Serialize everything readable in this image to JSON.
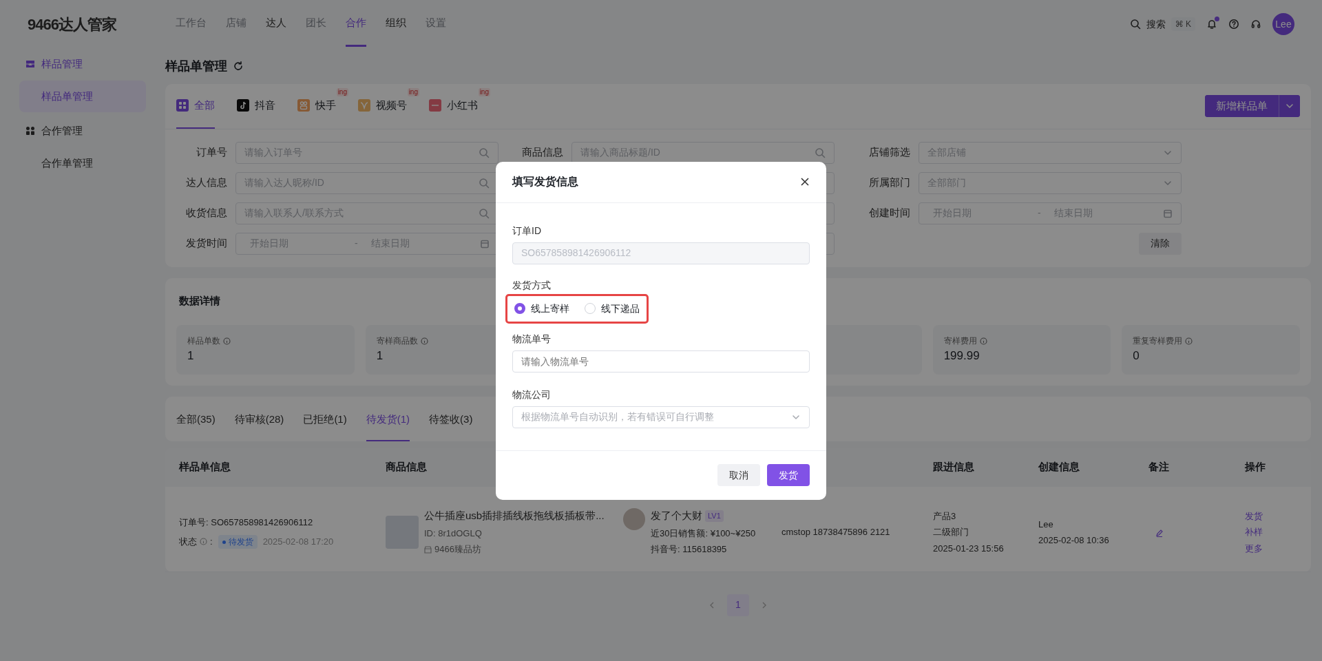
{
  "app": {
    "logo": "9466达人管家"
  },
  "nav": [
    {
      "label": "工作台",
      "disabled": true,
      "selected": false
    },
    {
      "label": "店铺",
      "disabled": true,
      "selected": false
    },
    {
      "label": "达人",
      "disabled": false,
      "selected": false
    },
    {
      "label": "团长",
      "disabled": true,
      "selected": false
    },
    {
      "label": "合作",
      "disabled": false,
      "selected": true
    },
    {
      "label": "组织",
      "disabled": false,
      "selected": false
    },
    {
      "label": "设置",
      "disabled": true,
      "selected": false
    }
  ],
  "toolbar": {
    "search_label": "搜索",
    "shortcut": "⌘ K",
    "notification_dot": true,
    "avatar": "Lee"
  },
  "sidebar": [
    {
      "label": "样品管理",
      "active": true,
      "children": [
        {
          "label": "样品单管理",
          "selected": true
        }
      ]
    },
    {
      "label": "合作管理",
      "active": false,
      "children": [
        {
          "label": "合作单管理",
          "selected": false
        }
      ]
    }
  ],
  "page": {
    "title": "样品单管理"
  },
  "platform_tabs": [
    {
      "label": "全部",
      "selected": true
    },
    {
      "label": "抖音",
      "selected": false
    },
    {
      "label": "快手",
      "selected": false,
      "badge": "ing"
    },
    {
      "label": "视频号",
      "selected": false,
      "badge": "ing"
    },
    {
      "label": "小红书",
      "selected": false,
      "badge": "ing"
    }
  ],
  "new_button": {
    "label": "新增样品单"
  },
  "filters": [
    {
      "kind": "search",
      "label": "订单号",
      "placeholder": "请输入订单号"
    },
    {
      "kind": "search",
      "label": "商品信息",
      "placeholder": "请输入商品标题/ID"
    },
    {
      "kind": "select",
      "label": "店铺筛选",
      "placeholder": "全部店铺"
    },
    {
      "kind": "search",
      "label": "达人信息",
      "placeholder": "请输入达人昵称/ID"
    },
    {
      "kind": "blank"
    },
    {
      "kind": "select",
      "label": "所属部门",
      "placeholder": "全部部门"
    },
    {
      "kind": "search",
      "label": "收货信息",
      "placeholder": "请输入联系人/联系方式"
    },
    {
      "kind": "blank"
    },
    {
      "kind": "daterange",
      "label": "创建时间",
      "start": "开始日期",
      "separator": "-",
      "end": "结束日期"
    },
    {
      "kind": "daterange",
      "label": "发货时间",
      "start": "开始日期",
      "separator": "-",
      "end": "结束日期"
    },
    {
      "kind": "blank"
    }
  ],
  "clear_button": "清除",
  "stats": {
    "title": "数据详情",
    "items": [
      {
        "kind": "stat",
        "label": "样品单数",
        "value": "1"
      },
      {
        "kind": "stat",
        "label": "寄样商品数",
        "value": "1"
      },
      {
        "kind": "blank"
      },
      {
        "kind": "blank"
      },
      {
        "kind": "stat",
        "label": "寄样费用",
        "value": "199.99"
      },
      {
        "kind": "stat",
        "label": "重复寄样费用",
        "value": "0"
      }
    ]
  },
  "status_tabs": [
    {
      "label": "全部(35)",
      "selected": false
    },
    {
      "label": "待审核(28)",
      "selected": false
    },
    {
      "label": "已拒绝(1)",
      "selected": false
    },
    {
      "label": "待发货(1)",
      "selected": true
    },
    {
      "label": "待签收(3)",
      "selected": false
    }
  ],
  "table": {
    "columns": [
      "样品单信息",
      "商品信息",
      null,
      null,
      "跟进信息",
      "创建信息",
      "备注",
      "操作"
    ],
    "rows": [
      {
        "order_no": "订单号:  SO657858981426906112",
        "status_label": "状态",
        "status_separator": ":",
        "status": "待发货",
        "status_time": "2025-02-08 17:20",
        "product_title": "公牛插座usb插排插线板拖线板插板带...",
        "product_id": "ID:  8r1dOGLQ",
        "shop": "9466臻品坊",
        "influencer": "发了个大财",
        "level": "LV1",
        "sales": "近30日销售额:  ¥100~¥250",
        "account": "抖音号:  115618395",
        "contact": "cmstop  18738475896 2121",
        "follow": [
          "产品3",
          "二级部门",
          "2025-01-23 15:56"
        ],
        "creator": "Lee",
        "created": "2025-02-08 10:36",
        "actions": [
          "发货",
          "补样",
          "更多"
        ]
      }
    ]
  },
  "pagination": [
    {
      "label": "1",
      "selected": true
    }
  ],
  "dialog": {
    "title": "填写发货信息",
    "order_id_label": "订单ID",
    "order_id": "SO657858981426906112",
    "method_label": "发货方式",
    "methods_highlighted": true,
    "methods": [
      {
        "label": "线上寄样",
        "selected": true
      },
      {
        "label": "线下递品",
        "selected": false
      }
    ],
    "tracking_label": "物流单号",
    "tracking_placeholder": "请输入物流单号",
    "carrier_label": "物流公司",
    "carrier_placeholder": "根据物流单号自动识别，若有错误可自行调整",
    "cancel": "取消",
    "confirm": "发货"
  }
}
